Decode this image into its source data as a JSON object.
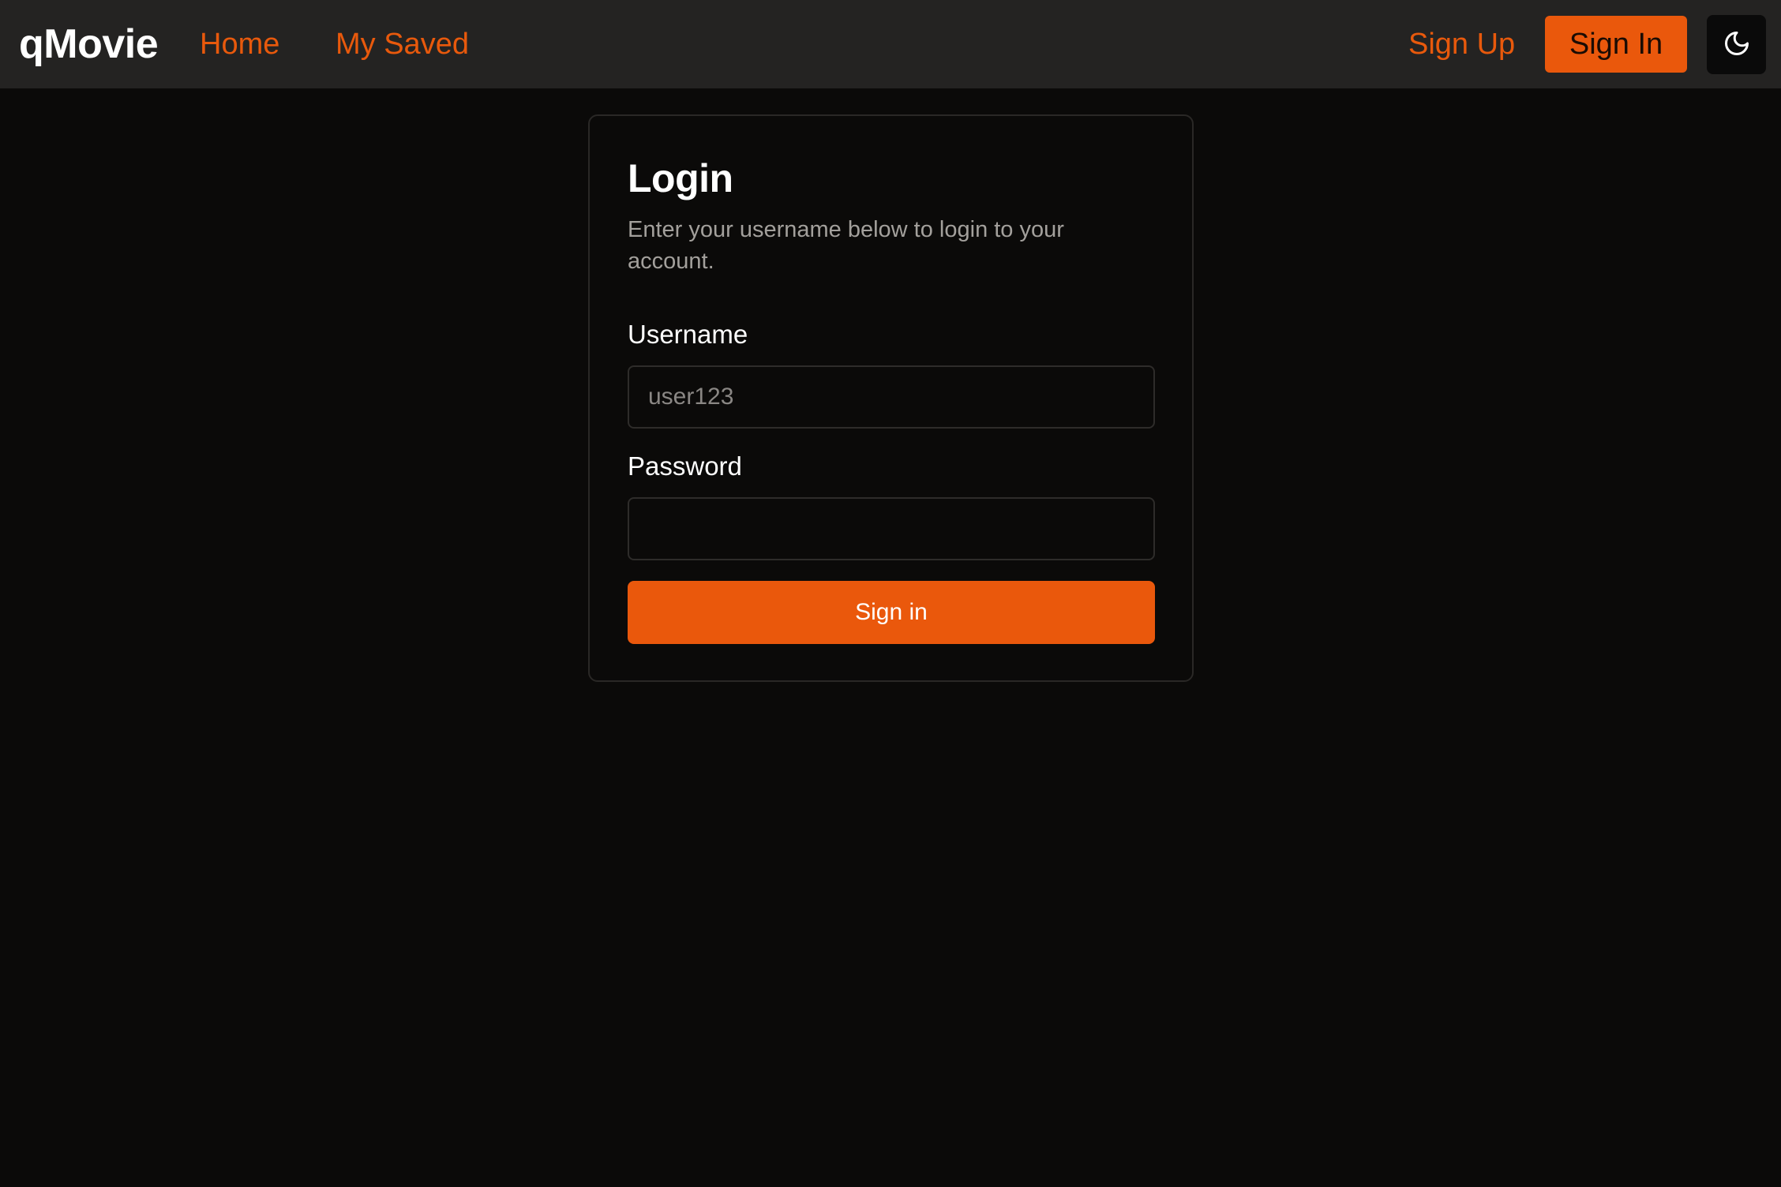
{
  "navbar": {
    "brand": "qMovie",
    "links": [
      {
        "label": "Home"
      },
      {
        "label": "My Saved"
      }
    ],
    "signup_label": "Sign Up",
    "signin_label": "Sign In",
    "theme_icon": "moon-icon"
  },
  "login": {
    "title": "Login",
    "description": "Enter your username below to login to your account.",
    "username_label": "Username",
    "username_placeholder": "user123",
    "username_value": "",
    "password_label": "Password",
    "password_value": "",
    "submit_label": "Sign in"
  },
  "colors": {
    "accent": "#ea580c",
    "background": "#0b0a09",
    "navbar_background": "#242322",
    "muted_text": "#a3a09c"
  }
}
